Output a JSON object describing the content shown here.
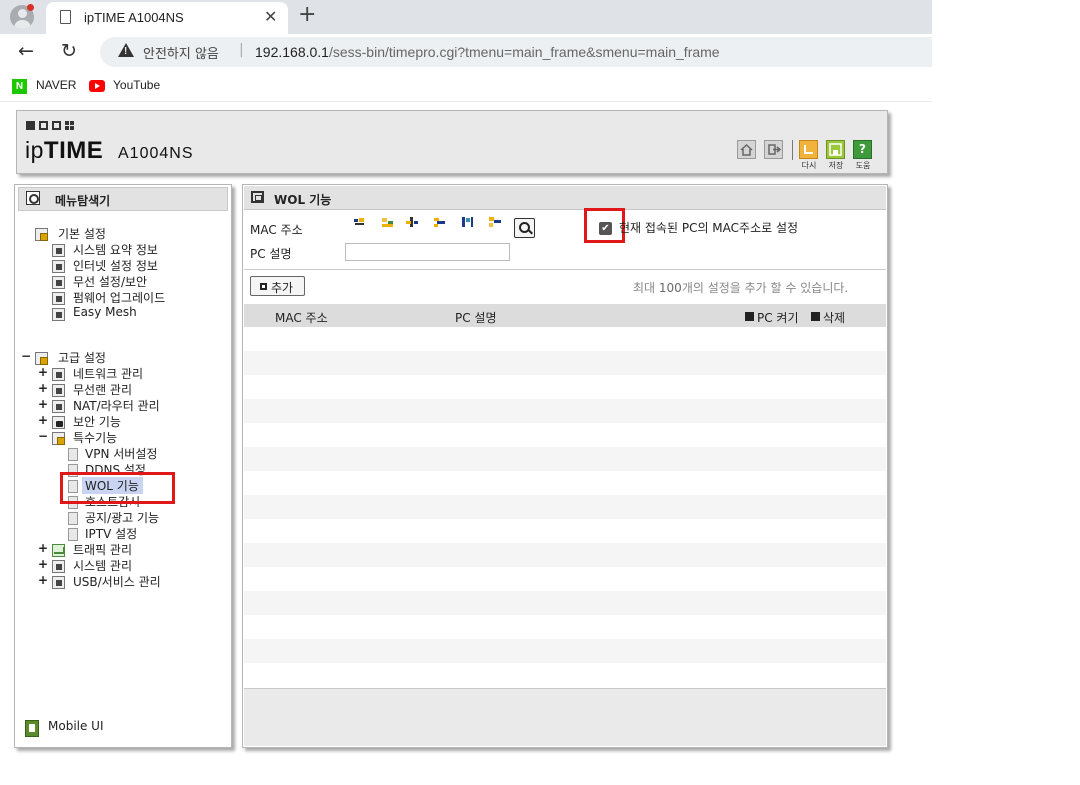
{
  "browser": {
    "tab_title": "ipTIME A1004NS",
    "security_label": "안전하지 않음",
    "url_host": "192.168.0.1",
    "url_path": "/sess-bin/timepro.cgi?tmenu=main_frame&smenu=main_frame",
    "bookmarks": [
      {
        "label": "NAVER",
        "icon": "naver-icon"
      },
      {
        "label": "YouTube",
        "icon": "youtube-icon"
      }
    ]
  },
  "header": {
    "brand_prefix": "ip",
    "brand_bold": "TIME",
    "model": "A1004NS",
    "buttons": [
      {
        "name": "home",
        "label": ""
      },
      {
        "name": "logout",
        "label": ""
      },
      {
        "name": "back",
        "label": "다시"
      },
      {
        "name": "save",
        "label": "저장"
      },
      {
        "name": "help",
        "label": "도움"
      }
    ]
  },
  "sidebar": {
    "title": "메뉴탐색기",
    "basic": {
      "label": "기본 설정",
      "items": [
        "시스템 요약 정보",
        "인터넷 설정 정보",
        "무선 설정/보안",
        "펌웨어 업그레이드",
        "Easy Mesh"
      ]
    },
    "advanced": {
      "label": "고급 설정",
      "items": [
        "네트워크 관리",
        "무선랜 관리",
        "NAT/라우터 관리",
        "보안 기능",
        "특수기능"
      ],
      "special_items": [
        "VPN 서버설정",
        "DDNS 설정",
        "WOL 기능",
        "호스트감시",
        "공지/광고 기능",
        "IPTV 설정"
      ],
      "more_items": [
        "트래픽 관리",
        "시스템 관리",
        "USB/서비스 관리"
      ]
    },
    "selected": "WOL 기능",
    "mobile_label": "Mobile UI"
  },
  "main": {
    "title": "WOL 기능",
    "mac_label": "MAC 주소",
    "pc_label": "PC 설명",
    "pc_value": "",
    "current_pc_checkbox_label": "현재 접속된 PC의 MAC주소로 설정",
    "current_pc_checked": true,
    "add_button": "추가",
    "max_note_prefix": "최대 ",
    "max_note_count": "100",
    "max_note_suffix": "개의 설정을 추가 할 수 있습니다.",
    "table_headers": {
      "mac": "MAC 주소",
      "pc": "PC 설명",
      "power_on": "PC 켜기",
      "delete": "삭제"
    },
    "rows": []
  }
}
